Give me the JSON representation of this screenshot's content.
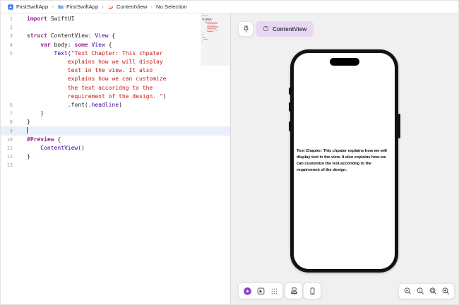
{
  "breadcrumb": {
    "separator": "›",
    "items": [
      {
        "label": "FirstSwiftApp",
        "icon": "app-project-icon"
      },
      {
        "label": "FirstSwiftApp",
        "icon": "folder-icon"
      },
      {
        "label": "ContentView",
        "icon": "swift-file-icon"
      },
      {
        "label": "No Selection",
        "icon": ""
      }
    ]
  },
  "editor": {
    "rows": [
      {
        "num": "1",
        "segments": [
          {
            "t": "import",
            "c": "kw"
          },
          {
            "t": " SwiftUI",
            "c": "pl"
          }
        ]
      },
      {
        "num": "2",
        "segments": []
      },
      {
        "num": "3",
        "segments": [
          {
            "t": "struct",
            "c": "kw"
          },
          {
            "t": " ContentView: ",
            "c": "pl"
          },
          {
            "t": "View",
            "c": "ty"
          },
          {
            "t": " {",
            "c": "pl"
          }
        ]
      },
      {
        "num": "4",
        "segments": [
          {
            "t": "    ",
            "c": "pl"
          },
          {
            "t": "var",
            "c": "kw"
          },
          {
            "t": " body: ",
            "c": "pl"
          },
          {
            "t": "some",
            "c": "kw"
          },
          {
            "t": " ",
            "c": "pl"
          },
          {
            "t": "View",
            "c": "ty"
          },
          {
            "t": " {",
            "c": "pl"
          }
        ]
      },
      {
        "num": "5",
        "segments": [
          {
            "t": "        ",
            "c": "pl"
          },
          {
            "t": "Text",
            "c": "ty"
          },
          {
            "t": "(",
            "c": "pl"
          },
          {
            "t": "\"Text Chapter: This chpater",
            "c": "st"
          }
        ]
      },
      {
        "num": "",
        "segments": [
          {
            "t": "            ",
            "c": "pl"
          },
          {
            "t": "explains how we will display",
            "c": "st"
          }
        ]
      },
      {
        "num": "",
        "segments": [
          {
            "t": "            ",
            "c": "pl"
          },
          {
            "t": "text in the view. It also",
            "c": "st"
          }
        ]
      },
      {
        "num": "",
        "segments": [
          {
            "t": "            ",
            "c": "pl"
          },
          {
            "t": "explains how we can customize",
            "c": "st"
          }
        ]
      },
      {
        "num": "",
        "segments": [
          {
            "t": "            ",
            "c": "pl"
          },
          {
            "t": "the text accoridng to the",
            "c": "st"
          }
        ]
      },
      {
        "num": "",
        "segments": [
          {
            "t": "            ",
            "c": "pl"
          },
          {
            "t": "requirement of the design. \"",
            "c": "st"
          },
          {
            "t": ")",
            "c": "pl"
          }
        ]
      },
      {
        "num": "6",
        "segments": [
          {
            "t": "            .font(",
            "c": "pl"
          },
          {
            "t": ".headline",
            "c": "ty"
          },
          {
            "t": ")",
            "c": "pl"
          }
        ]
      },
      {
        "num": "7",
        "segments": [
          {
            "t": "    }",
            "c": "pl"
          }
        ]
      },
      {
        "num": "8",
        "segments": [
          {
            "t": "}",
            "c": "pl"
          }
        ]
      },
      {
        "num": "9",
        "segments": [],
        "current": true,
        "cursor": true
      },
      {
        "num": "10",
        "segments": [
          {
            "t": "#Preview",
            "c": "mac"
          },
          {
            "t": " {",
            "c": "pl"
          }
        ]
      },
      {
        "num": "11",
        "segments": [
          {
            "t": "    ",
            "c": "pl"
          },
          {
            "t": "ContentView",
            "c": "ty"
          },
          {
            "t": "()",
            "c": "pl"
          }
        ]
      },
      {
        "num": "12",
        "segments": [
          {
            "t": "}",
            "c": "pl"
          }
        ]
      },
      {
        "num": "13",
        "segments": []
      }
    ]
  },
  "canvas": {
    "preview_tab": {
      "label": "ContentView",
      "icon": "app-window-icon"
    },
    "pin_button": {
      "icon": "pin-icon"
    },
    "device_preview": {
      "text": "Text Chapter: This chpater explains how we will\ndisplay text in the view. It also explains how we\ncan customize the text accoridng to the\nrequirement of the design."
    },
    "toolbar_groups": [
      [
        {
          "name": "live-preview",
          "icon": "play-icon"
        },
        {
          "name": "select-mode",
          "icon": "pointer-icon"
        },
        {
          "name": "variants",
          "icon": "grid-icon"
        }
      ],
      [
        {
          "name": "device-settings",
          "icon": "device-settings-icon"
        }
      ],
      [
        {
          "name": "device",
          "icon": "device-icon"
        }
      ]
    ],
    "zoom_controls": [
      {
        "name": "zoom-out",
        "icon": "magnifier-minus-icon"
      },
      {
        "name": "zoom-actual-size",
        "icon": "magnifier-one-icon"
      },
      {
        "name": "zoom-to-fit",
        "icon": "magnifier-fit-icon"
      },
      {
        "name": "zoom-in",
        "icon": "magnifier-plus-icon"
      }
    ]
  },
  "colors": {
    "keyword": "#9b2393",
    "type": "#3900a0",
    "string": "#c41a16",
    "plain": "#1d1d1f",
    "current_line": "#e9effb",
    "pill_background": "#e7d7f3",
    "live_button": "#8b44c9",
    "swift_orange": "#f05138"
  }
}
